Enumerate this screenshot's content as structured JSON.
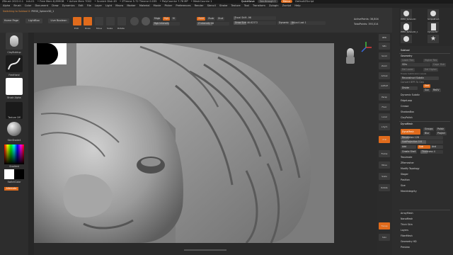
{
  "titlebar": {
    "app": "ZBrush 2022.0.1",
    "doc": "Init-01",
    "free_mem": "• Free Mem 8,899GB",
    "active_mem": "• Active Mem 7002",
    "scratch": "• Scratch Disk 49",
    "ztime": "• ZTime≥ 5.72 Timer≥ 0.035",
    "polycount": "• PolyCount≥ 7.76 MP",
    "meshcount": "• MeshCount≥ 1",
    "quicksave": "QuickSave",
    "see_through": "See-through 0",
    "menus": "Menus",
    "default_script": "DefaultZScript"
  },
  "menubar": [
    "Alpha",
    "Brush",
    "Color",
    "Document",
    "Draw",
    "Dynamics",
    "Edit",
    "File",
    "Layer",
    "Light",
    "Macro",
    "Marker",
    "Material",
    "Movie",
    "Picker",
    "Preferences",
    "Render",
    "Stencil",
    "Stroke",
    "Texture",
    "Tool",
    "Transform",
    "Zplugin",
    "Zscript",
    "Help"
  ],
  "shelf": {
    "switching_prefix": "Switching to Subtool 0:",
    "switching_name": "PM3D_Sphere3D_1",
    "home_page": "Home Page",
    "lightbox": "LightBox",
    "live_boolean": "Live Boolean",
    "tools": [
      {
        "label": "Edit",
        "on": true
      },
      {
        "label": "Draw",
        "on": true
      },
      {
        "label": "Move",
        "on": false
      },
      {
        "label": "Scale",
        "on": false
      },
      {
        "label": "Rotate",
        "on": false
      }
    ],
    "mrgb": "Mrgb",
    "rgb": "Rgb",
    "m": "M",
    "zadd": "Zadd",
    "zsub": "Zsub",
    "zcut": "Zcut",
    "rgb_intensity": "Rgb Intensity",
    "z_intensity": "Z Intensity",
    "z_intensity_value": "48",
    "focal_shift_label": "Focal Shift",
    "focal_shift_value": "-96",
    "draw_size_label": "Draw Size",
    "draw_size_value": "46.62372",
    "dynamic": "Dynamic",
    "adjust_last": "Adjust Last",
    "adjust_last_value": "1",
    "active_points_label": "ActivePoints:",
    "active_points": "36,804",
    "total_points_label": "TotalPoints:",
    "total_points": "393,014"
  },
  "lefttray": {
    "brush_label": "ClayBuildup",
    "stroke_label": "FreeHand",
    "alpha_label": "Brush Alpha",
    "texture_label": "Texture Off",
    "material_label": "SkinShade4",
    "gradient_label": "Gradient",
    "switch_color": "SwitchColor",
    "alternate": "Alternate"
  },
  "rightshelf": [
    "BPR",
    "SPix",
    "Scroll",
    "Zoom",
    "Actual",
    "AAHalf",
    "Persp",
    "Floor",
    "Local",
    "L.Sym",
    "XYZ",
    "Frame",
    "Move",
    "Scale",
    "Rotate",
    "Transp",
    "Solo"
  ],
  "rightpanel": {
    "subtool_thumbs": [
      "PM3D_Sphere3D",
      "SimpleBrush",
      "PM3D_Sphere3D_1",
      "Cylinder3D",
      "ZSphere",
      "PM3D_1",
      "PolyMesh3D",
      "Star3D"
    ],
    "subtool": "Subtool",
    "geometry": "Geometry",
    "lower_res": "Lower Res",
    "higher_res": "Higher Res",
    "sdiv": "SDiv",
    "cage": "Cage",
    "rstr": "Rstr",
    "del_lower": "Del Lower",
    "del_higher": "Del Higher",
    "freeze_subdiv": "Freeze SubDivision Levels",
    "reconstruct_subdiv": "Reconstruct Subdiv",
    "convert_bpr": "Convert BPR To Geo",
    "divide": "Divide",
    "smt": "Smt",
    "suv": "Suv",
    "reuv": "ReUV",
    "dynamic_subdiv": "Dynamic Subdiv",
    "edgeloop": "EdgeLoop",
    "crease": "Crease",
    "shadowbox": "ShadowBox",
    "claypolish": "ClayPolish",
    "dynamesh_hdr": "DynaMesh",
    "dynamesh_btn": "DynaMesh",
    "groups": "Groups",
    "polish": "Polish",
    "blur": "Blur",
    "project": "Project",
    "resolution_label": "Resolution",
    "resolution": "128",
    "subprojection_label": "SubProjection",
    "subprojection": "0.6",
    "add": "Add",
    "sub": "Sub",
    "and": "And",
    "create_shell": "Create Shell",
    "thickness_label": "Thickness",
    "thickness": "4",
    "tessimate": "Tessimate",
    "zremesher": "ZRemesher",
    "modify_topology": "Modify Topology",
    "stager": "Stager",
    "position": "Position",
    "size": "Size",
    "mesh_integrity": "MeshIntegrity",
    "array_mesh": "ArrayMesh",
    "nano_mesh": "NanoMesh",
    "thick_skin": "Thick Skin",
    "layers": "Layers",
    "fiber_mesh": "FiberMesh",
    "geometry_hd": "Geometry HD",
    "preview": "Preview"
  },
  "colors": {
    "accent": "#e06b1c",
    "panel": "#2d2d2d",
    "viewport": "#787878"
  }
}
